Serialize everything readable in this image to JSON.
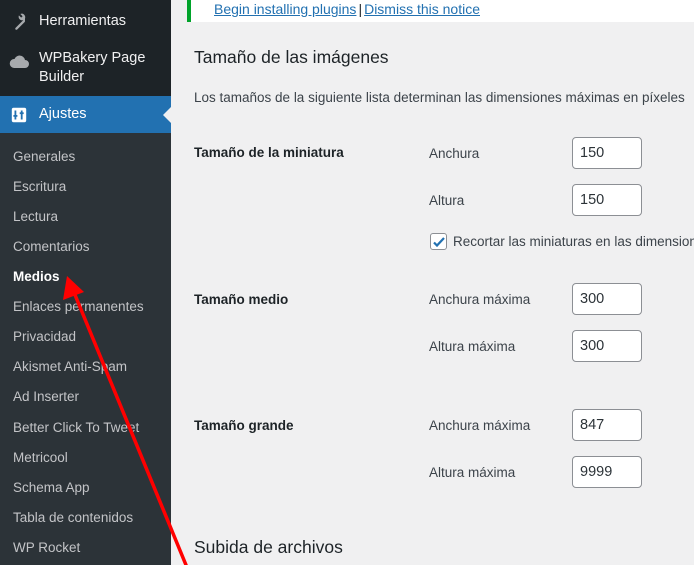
{
  "sidebar": {
    "menu": [
      {
        "label": "Herramientas",
        "icon": "wrench-icon"
      },
      {
        "label": "WPBakery Page Builder",
        "icon": "cloud-icon"
      },
      {
        "label": "Ajustes",
        "icon": "settings-icon",
        "active": true
      }
    ],
    "submenu": [
      {
        "label": "Generales"
      },
      {
        "label": "Escritura"
      },
      {
        "label": "Lectura"
      },
      {
        "label": "Comentarios"
      },
      {
        "label": "Medios",
        "current": true
      },
      {
        "label": "Enlaces permanentes"
      },
      {
        "label": "Privacidad"
      },
      {
        "label": "Akismet Anti-Spam"
      },
      {
        "label": "Ad Inserter"
      },
      {
        "label": "Better Click To Tweet"
      },
      {
        "label": "Metricool"
      },
      {
        "label": "Schema App"
      },
      {
        "label": "Tabla de contenidos"
      },
      {
        "label": "WP Rocket"
      }
    ]
  },
  "notice": {
    "install_link": "Begin installing plugins",
    "separator": "|",
    "dismiss_link": "Dismiss this notice"
  },
  "sizes": {
    "heading": "Tamaño de las imágenes",
    "description": "Los tamaños de la siguiente lista determinan las dimensiones máximas en píxeles",
    "thumbnail": {
      "label": "Tamaño de la miniatura",
      "width_label": "Anchura",
      "width_value": "150",
      "height_label": "Altura",
      "height_value": "150",
      "crop_label": "Recortar las miniaturas en las dimensiones",
      "crop_checked": true
    },
    "medium": {
      "label": "Tamaño medio",
      "width_label": "Anchura máxima",
      "width_value": "300",
      "height_label": "Altura máxima",
      "height_value": "300"
    },
    "large": {
      "label": "Tamaño grande",
      "width_label": "Anchura máxima",
      "width_value": "847",
      "height_label": "Altura máxima",
      "height_value": "9999"
    }
  },
  "uploads": {
    "heading": "Subida de archivos"
  },
  "colors": {
    "sidebar_bg": "#1d2327",
    "submenu_bg": "#2c3338",
    "accent": "#2271b1",
    "notice_border": "#00a32a",
    "arrow": "#ff0000"
  }
}
